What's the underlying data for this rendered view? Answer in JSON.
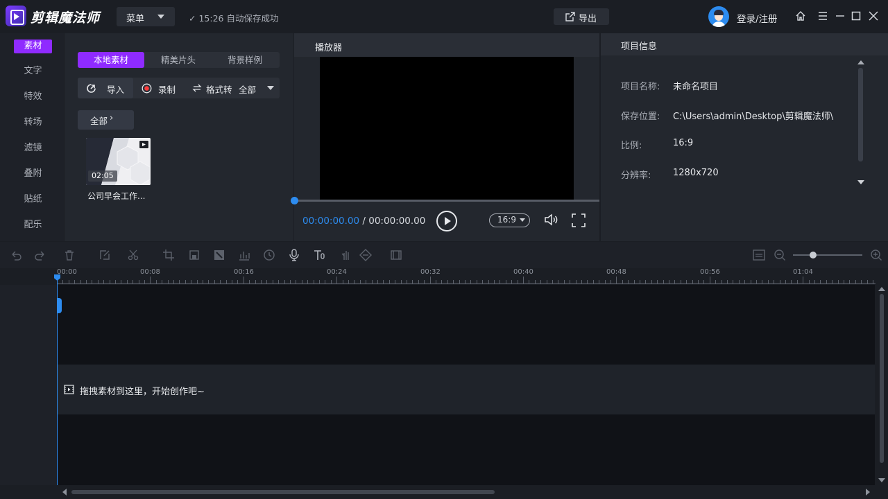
{
  "app": {
    "title": "剪辑魔法师"
  },
  "titlebar": {
    "menu_label": "菜单",
    "save_status": "15:26 自动保存成功",
    "export_label": "导出",
    "login_label": "登录/注册"
  },
  "leftnav": {
    "items": [
      {
        "label": "素材",
        "active": true
      },
      {
        "label": "文字"
      },
      {
        "label": "特效"
      },
      {
        "label": "转场"
      },
      {
        "label": "滤镜"
      },
      {
        "label": "叠附"
      },
      {
        "label": "贴纸"
      },
      {
        "label": "配乐"
      }
    ]
  },
  "material": {
    "tabs": [
      "本地素材",
      "精美片头",
      "背景样例"
    ],
    "import_label": "导入",
    "record_label": "录制",
    "format_label": "格式转",
    "filter_value": "全部",
    "folder_label": "全部",
    "items": [
      {
        "name": "公司早会工作...",
        "duration": "02:05"
      }
    ]
  },
  "player": {
    "title": "播放器",
    "current_time": "00:00:00.00",
    "separator": " / ",
    "total_time": "00:00:00.00",
    "ratio": "16:9",
    "progress": 0
  },
  "project_info": {
    "title": "项目信息",
    "rows": [
      {
        "label": "项目名称:",
        "value": "未命名项目"
      },
      {
        "label": "保存位置:",
        "value": "C:\\Users\\admin\\Desktop\\剪辑魔法师\\"
      },
      {
        "label": "比例:",
        "value": "16:9"
      },
      {
        "label": "分辨率:",
        "value": "1280x720"
      }
    ]
  },
  "timeline": {
    "ruler_ticks": [
      "00:00",
      "00:08",
      "00:16",
      "00:24",
      "00:32",
      "00:40",
      "00:48",
      "00:56",
      "01:04"
    ],
    "drop_hint": "拖拽素材到这里，开始创作吧~"
  },
  "colors": {
    "accent": "#8f2bff",
    "playhead": "#2d8cf0"
  }
}
